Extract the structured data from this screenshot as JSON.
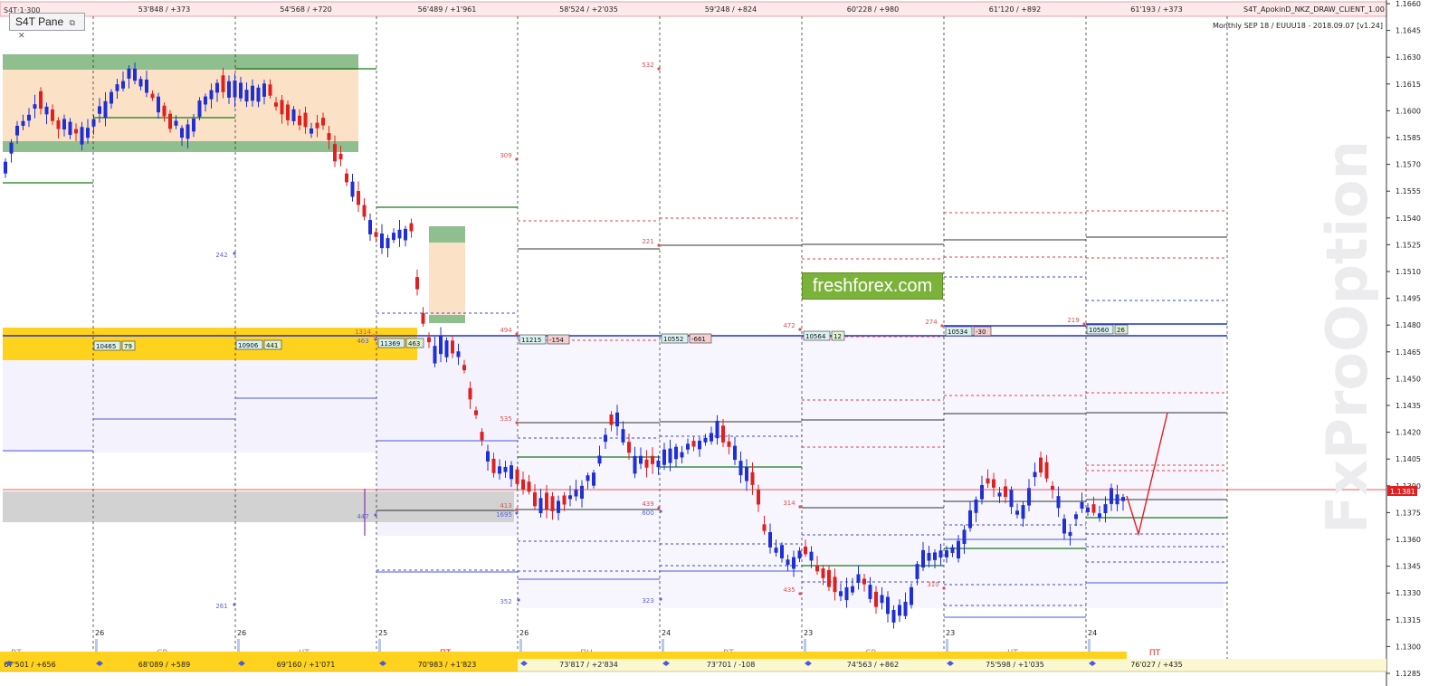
{
  "window": {
    "top_left_label": "S4T Pane",
    "indicator_title": "S4T_ApokinD_NKZ_DRAW_CLIENT_1.00",
    "indicator_subtitle": "Monthly SEP 18 / EUUU18 - 2018.09.07 [v1.24]",
    "pane_controls": [
      "⧉",
      "✕"
    ]
  },
  "brand": {
    "label": "freshforex.com",
    "color": "#7bb33a"
  },
  "watermark": {
    "label": "FxProOptions"
  },
  "colors": {
    "bull": "#1f2fd6",
    "bear": "#e02020",
    "zone_fill": "#fbe2c6",
    "zone_edge": "#8fbe8f",
    "yellow": "#ffd21e",
    "gray": "#d2d2d2",
    "current_price": "#e02020"
  },
  "top_axis": [
    {
      "label": "53'848 / +373"
    },
    {
      "label": "54'568 / +720"
    },
    {
      "label": "56'489 / +1'961"
    },
    {
      "label": "58'524 / +2'035"
    },
    {
      "label": "59'248 / +824"
    },
    {
      "label": "60'228 / +980"
    },
    {
      "label": "61'120 / +892"
    },
    {
      "label": "61'193 / +373"
    }
  ],
  "price_axis": {
    "labels": [
      "1.1660",
      "1.1645",
      "1.1630",
      "1.1615",
      "1.1600",
      "1.1585",
      "1.1570",
      "1.1555",
      "1.1540",
      "1.1525",
      "1.1510",
      "1.1495",
      "1.1480",
      "1.1465",
      "1.1450",
      "1.1435",
      "1.1420",
      "1.1405",
      "1.1390",
      "1.1375",
      "1.1360",
      "1.1345",
      "1.1330",
      "1.1315",
      "1.1300",
      "1.1285"
    ],
    "current_price": "1.1381"
  },
  "day_labels": [
    {
      "num": "",
      "day": "ВТ"
    },
    {
      "num": "26",
      "day": "СР"
    },
    {
      "num": "26",
      "day": "ЧТ"
    },
    {
      "num": "25",
      "day": "ПТ"
    },
    {
      "num": "26",
      "day": "ПН"
    },
    {
      "num": "24",
      "day": "ВТ"
    },
    {
      "num": "23",
      "day": "СР"
    },
    {
      "num": "23",
      "day": "ЧТ"
    },
    {
      "num": "24",
      "day": "ПТ"
    }
  ],
  "bottom_axis": [
    {
      "label": "67'501 / +656"
    },
    {
      "label": "68'089 / +589"
    },
    {
      "label": "69'160 / +1'071"
    },
    {
      "label": "70'983 / +1'823"
    },
    {
      "label": "73'817 / +2'834"
    },
    {
      "label": "73'701 / -108"
    },
    {
      "label": "74'563 / +862"
    },
    {
      "label": "75'598 / +1'035"
    },
    {
      "label": "76'027 / +435"
    }
  ],
  "tags": [
    {
      "value": "10465",
      "delta": "79"
    },
    {
      "value": "10906",
      "delta": "441"
    },
    {
      "value": "11369",
      "delta": "463"
    },
    {
      "value": "11215",
      "delta": "-154"
    },
    {
      "value": "10552",
      "delta": "-661"
    },
    {
      "value": "10564",
      "delta": "12"
    },
    {
      "value": "10534",
      "delta": "-30"
    },
    {
      "value": "10560",
      "delta": "26"
    }
  ],
  "annotations": {
    "red": [
      "532",
      "309",
      "221",
      "494",
      "535",
      "439",
      "413",
      "472",
      "314",
      "435",
      "274",
      "310",
      "219",
      "1314"
    ],
    "blue": [
      "242",
      "261",
      "447",
      "463",
      "352",
      "323",
      "600",
      "1695"
    ]
  }
}
